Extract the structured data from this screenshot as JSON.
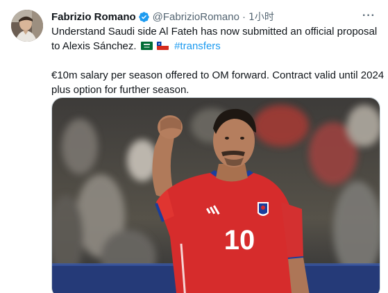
{
  "author": {
    "name": "Fabrizio Romano",
    "handle": "@FabrizioRomano",
    "separator": "·",
    "time": "1小时"
  },
  "tweet": {
    "line1": "Understand Saudi side Al Fateh has now submitted an official proposal to Alexis Sánchez.",
    "hashtag": "#transfers",
    "line2": "€10m salary per season offered to OM forward. Contract valid until 2024 plus option for further season."
  },
  "media": {
    "jersey_number": "10"
  },
  "icons": {
    "verified": "verified-badge-icon",
    "more": "more-options-icon",
    "flag_saudi": "saudi-flag-icon",
    "flag_chile": "chile-flag-icon"
  },
  "colors": {
    "link": "#1d9bf0",
    "verified": "#1d9bf0",
    "secondary_text": "#536471",
    "jersey_red": "#d62c2c"
  }
}
